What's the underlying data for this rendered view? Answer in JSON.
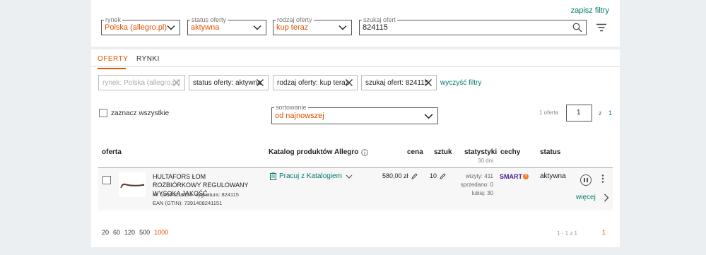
{
  "filters": {
    "save_filters": "zapisz filtry",
    "market": {
      "legend": "rynek",
      "value": "Polska (allegro.pl)"
    },
    "status": {
      "legend": "status oferty",
      "value": "aktywna"
    },
    "type": {
      "legend": "rodzaj oferty",
      "value": "kup teraz"
    },
    "search": {
      "legend": "szukaj ofert",
      "value": "824115"
    }
  },
  "tabs": [
    {
      "label": "OFERTY"
    },
    {
      "label": "RYNKI"
    }
  ],
  "chips": {
    "market": "rynek: Polska (allegro.pl)",
    "status": "status oferty: aktywna",
    "type": "rodzaj oferty: kup teraz",
    "search": "szukaj ofert: 824115",
    "clear": "wyczyść filtry"
  },
  "list": {
    "select_all": "zaznacz wszystkie",
    "sort": {
      "legend": "sortowanie",
      "value": "od najnowszej"
    },
    "pagination": {
      "count": "1 oferta",
      "page": "1",
      "of": "z",
      "total": "1"
    }
  },
  "table": {
    "headers": {
      "offer": "oferta",
      "catalog": "Katalog produktów Allegro",
      "price": "cena",
      "qty": "sztuk",
      "stats": "statystyki",
      "stats_sub": "30 dni",
      "features": "cechy",
      "status": "status"
    },
    "row": {
      "title": "HULTAFORS ŁOM ROZBIÓRKOWY REGULOWANY WYSOKA JAKOŚĆ",
      "nr_label": "nr:",
      "nr": "13364218114",
      "signature_label": "sygnatura:",
      "signature": "824115",
      "ean_label": "EAN (GTIN):",
      "ean": "7391408241151",
      "catalog_action": "Pracuj z Katalogiem",
      "price": "580,00 zł",
      "qty": "10",
      "visits": "wizyty: 411",
      "sold": "sprzedano: 0",
      "likes": "lubią: 30",
      "smart": "SMART",
      "status": "aktywna",
      "more": "więcej"
    }
  },
  "footer": {
    "per_page": [
      "20",
      "60",
      "120",
      "500",
      "1000"
    ],
    "active_per_page": "1000",
    "page_info": "1 - 1 z 1",
    "current_page": "1"
  },
  "colors": {
    "accent": "#e55100",
    "link": "#00796b",
    "smart": "#4a1e8a"
  }
}
